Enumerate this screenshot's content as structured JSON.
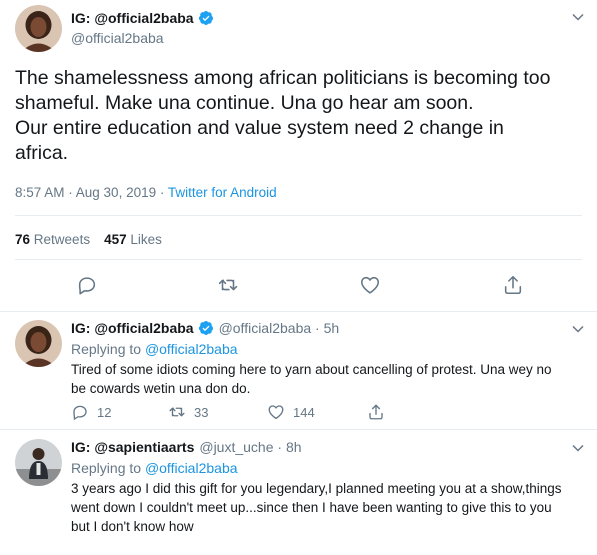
{
  "main_tweet": {
    "display_name": "IG: @official2baba",
    "handle": "@official2baba",
    "text_lines": [
      "The shamelessness among african politicians is becoming too",
      "shameful. Make una continue. Una go hear am soon.",
      "Our entire education and value system need 2 change in",
      "africa."
    ],
    "time": "8:57 AM · Aug 30, 2019 · ",
    "source": "Twitter for Android",
    "retweets_count": "76",
    "retweets_label": "Retweets",
    "likes_count": "457",
    "likes_label": "Likes"
  },
  "replies": [
    {
      "display_name": "IG: @official2baba",
      "handle": "@official2baba · 5h",
      "replying_label": "Replying to ",
      "replying_to": "@official2baba",
      "text_lines": [
        "Tired of some idiots coming here to yarn about cancelling of protest. Una wey no",
        "be cowards wetin una don do."
      ],
      "reply_count": "12",
      "retweet_count": "33",
      "like_count": "144"
    },
    {
      "display_name": "IG: @sapientiaarts",
      "handle": "@juxt_uche · 8h",
      "replying_label": "Replying to ",
      "replying_to": "@official2baba",
      "text_lines": [
        "3 years ago I did this gift for you legendary,I planned meeting you at a show,things",
        "went down I couldn't meet up...since then I have been wanting to give this to you",
        "but I don't know how"
      ]
    }
  ],
  "colors": {
    "accent": "#1b95e0",
    "secondary_text": "#657786",
    "verified_blue": "#1da1f2"
  },
  "icons": {
    "verified": "verified-badge-icon",
    "caret": "chevron-down-icon",
    "reply": "reply-icon",
    "retweet": "retweet-icon",
    "like": "heart-icon",
    "share": "share-icon"
  }
}
